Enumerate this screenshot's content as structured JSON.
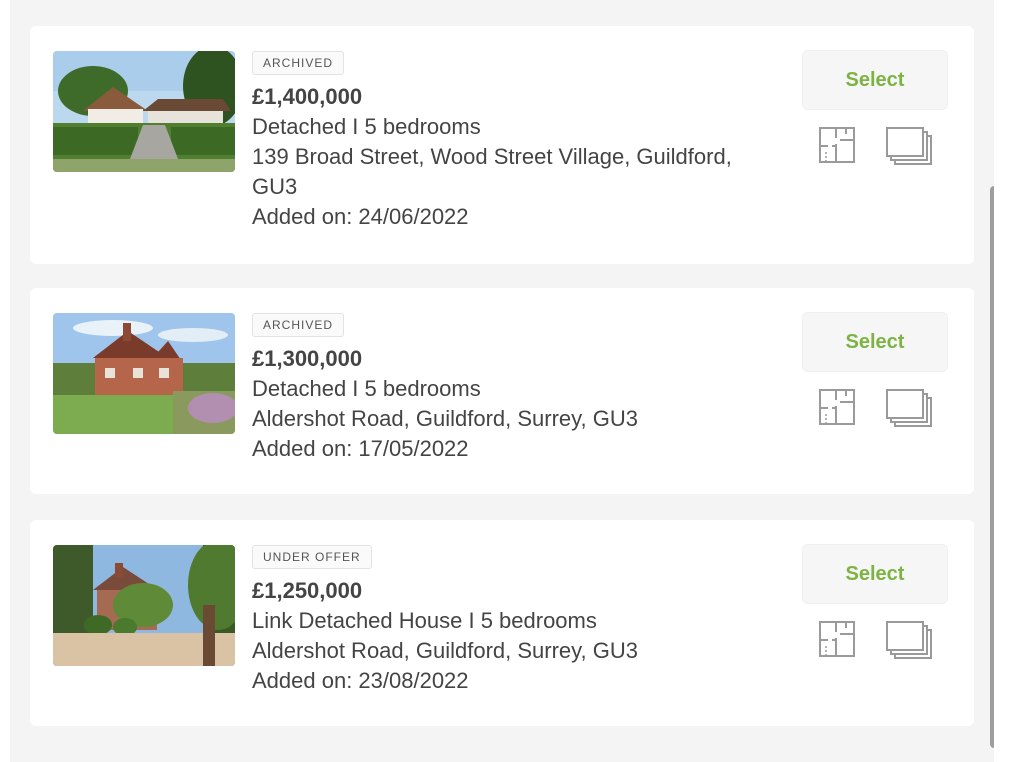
{
  "listings": [
    {
      "status": "ARCHIVED",
      "price": "£1,400,000",
      "type": "Detached I 5 bedrooms",
      "address_line1": "139 Broad Street, Wood Street Village, Guildford,",
      "address_line2": "GU3",
      "added": "Added on: 24/06/2022",
      "select_label": "Select",
      "floorplan_icon": "floorplan-icon",
      "gallery_icon": "gallery-icon"
    },
    {
      "status": "ARCHIVED",
      "price": "£1,300,000",
      "type": "Detached I 5 bedrooms",
      "address_line1": "Aldershot Road, Guildford, Surrey, GU3",
      "added": "Added on: 17/05/2022",
      "select_label": "Select",
      "floorplan_icon": "floorplan-icon",
      "gallery_icon": "gallery-icon"
    },
    {
      "status": "UNDER OFFER",
      "price": "£1,250,000",
      "type": "Link Detached House I 5 bedrooms",
      "address_line1": "Aldershot Road, Guildford, Surrey, GU3",
      "added": "Added on: 23/08/2022",
      "select_label": "Select",
      "floorplan_icon": "floorplan-icon",
      "gallery_icon": "gallery-icon"
    }
  ],
  "colors": {
    "accent": "#7cb342",
    "text": "#444444",
    "background": "#f4f4f4",
    "card": "#ffffff"
  }
}
